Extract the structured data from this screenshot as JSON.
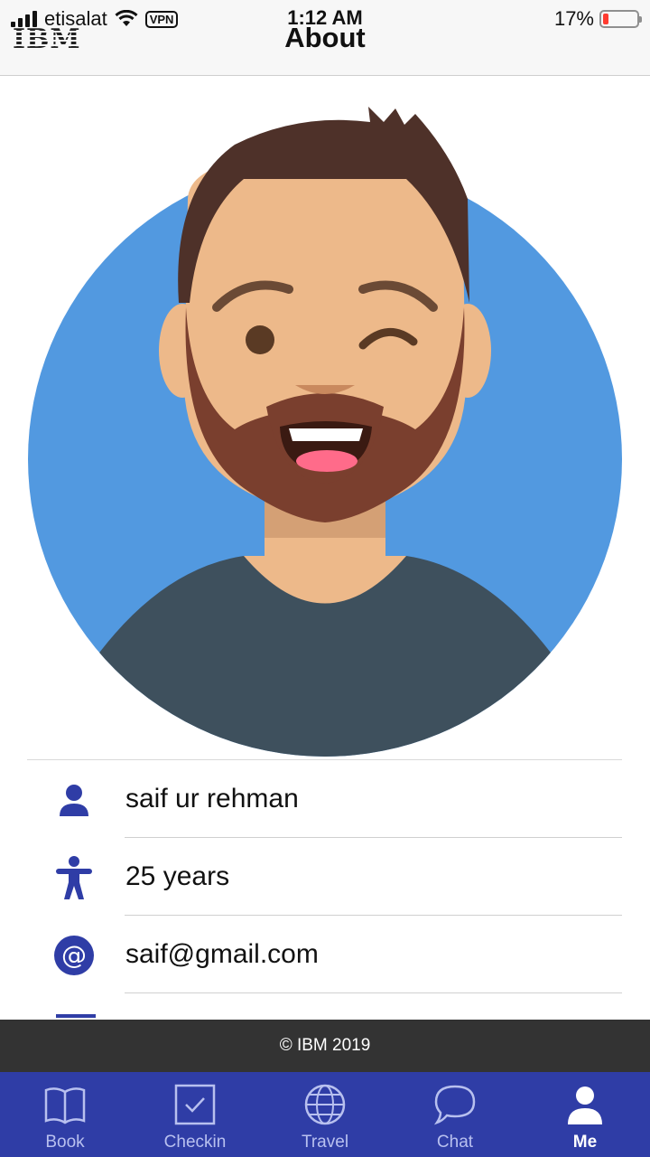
{
  "status_bar": {
    "carrier": "etisalat",
    "vpn_label": "VPN",
    "time": "1:12 AM",
    "battery_percent": "17%",
    "battery_level": 0.17
  },
  "header": {
    "logo_text": "IBM",
    "title": "About"
  },
  "avatar": {
    "icon": "user-avatar-illustration",
    "colors": {
      "background": "#5299e0",
      "skin": "#edb98a",
      "hair": "#4e3129",
      "beard": "#7a3f2e",
      "shirt": "#3e505d"
    }
  },
  "profile": {
    "items": [
      {
        "icon": "person-icon",
        "value": "saif ur rehman"
      },
      {
        "icon": "accessibility-icon",
        "value": "25 years"
      },
      {
        "icon": "at-sign-icon",
        "value": "saif@gmail.com"
      }
    ]
  },
  "footer": {
    "copyright": "© IBM 2019"
  },
  "tabbar": {
    "accent": "#2f3da6",
    "tabs": [
      {
        "label": "Book",
        "icon": "book-icon",
        "active": false
      },
      {
        "label": "Checkin",
        "icon": "checkbox-icon",
        "active": false
      },
      {
        "label": "Travel",
        "icon": "globe-icon",
        "active": false
      },
      {
        "label": "Chat",
        "icon": "chat-bubble-icon",
        "active": false
      },
      {
        "label": "Me",
        "icon": "user-icon",
        "active": true
      }
    ]
  }
}
